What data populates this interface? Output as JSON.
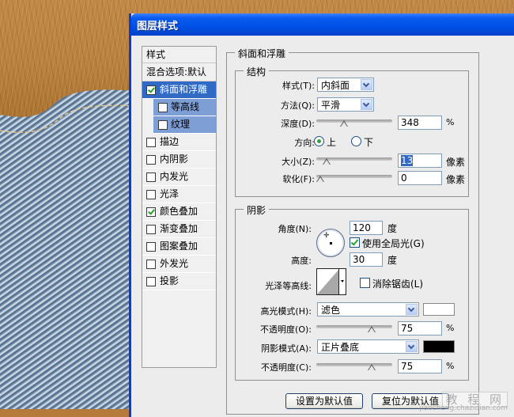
{
  "dialog": {
    "title": "图层样式"
  },
  "styles_list": {
    "header": "样式",
    "blend_options": "混合选项:默认",
    "items": [
      {
        "label": "斜面和浮雕",
        "checked": true,
        "selected": true,
        "sub": false
      },
      {
        "label": "等高线",
        "checked": false,
        "selected": false,
        "sub": true
      },
      {
        "label": "纹理",
        "checked": false,
        "selected": false,
        "sub": true
      },
      {
        "label": "描边",
        "checked": false,
        "selected": false,
        "sub": false
      },
      {
        "label": "内阴影",
        "checked": false,
        "selected": false,
        "sub": false
      },
      {
        "label": "内发光",
        "checked": false,
        "selected": false,
        "sub": false
      },
      {
        "label": "光泽",
        "checked": false,
        "selected": false,
        "sub": false
      },
      {
        "label": "颜色叠加",
        "checked": true,
        "selected": false,
        "sub": false
      },
      {
        "label": "渐变叠加",
        "checked": false,
        "selected": false,
        "sub": false
      },
      {
        "label": "图案叠加",
        "checked": false,
        "selected": false,
        "sub": false
      },
      {
        "label": "外发光",
        "checked": false,
        "selected": false,
        "sub": false
      },
      {
        "label": "投影",
        "checked": false,
        "selected": false,
        "sub": false
      }
    ]
  },
  "bevel": {
    "section_title": "斜面和浮雕",
    "structure": {
      "title": "结构",
      "style_label": "样式(T):",
      "style_value": "内斜面",
      "technique_label": "方法(Q):",
      "technique_value": "平滑",
      "depth_label": "深度(D):",
      "depth_value": "348",
      "depth_unit": "%",
      "depth_slider_fraction": 0.35,
      "direction_label": "方向:",
      "direction_up": "上",
      "direction_down": "下",
      "direction_selected": "up",
      "size_label": "大小(Z):",
      "size_value": "13",
      "size_unit": "像素",
      "size_slider_fraction": 0.09,
      "soften_label": "软化(F):",
      "soften_value": "0",
      "soften_unit": "像素",
      "soften_slider_fraction": 0.0
    },
    "shading": {
      "title": "阴影",
      "angle_label": "角度(N):",
      "angle_value": "120",
      "angle_unit": "度",
      "global_light_label": "使用全局光(G)",
      "global_light_checked": true,
      "altitude_label": "高度:",
      "altitude_value": "30",
      "altitude_unit": "度",
      "gloss_contour_label": "光泽等高线:",
      "anti_aliased_label": "消除锯齿(L)",
      "anti_aliased_checked": false,
      "highlight_mode_label": "高光模式(H):",
      "highlight_mode_value": "滤色",
      "highlight_color": "#ffffff",
      "highlight_opacity_label": "不透明度(O):",
      "highlight_opacity_value": "75",
      "highlight_opacity_unit": "%",
      "highlight_opacity_fraction": 0.75,
      "shadow_mode_label": "阴影模式(A):",
      "shadow_mode_value": "正片叠底",
      "shadow_color": "#000000",
      "shadow_opacity_label": "不透明度(C):",
      "shadow_opacity_value": "75",
      "shadow_opacity_unit": "%",
      "shadow_opacity_fraction": 0.75
    },
    "buttons": {
      "make_default": "设置为默认值",
      "reset_default": "复位为默认值"
    }
  },
  "watermark": {
    "text": "教 程 网",
    "url": "jiaocheng.chazidian.com"
  }
}
